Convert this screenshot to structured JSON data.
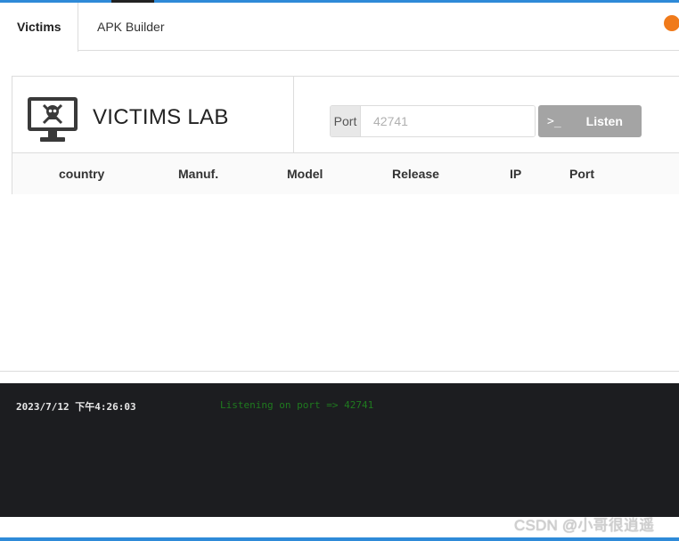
{
  "tabs": [
    {
      "label": "Victims",
      "active": true
    },
    {
      "label": "APK Builder",
      "active": false
    }
  ],
  "status_indicator": {
    "color": "#f07a1a"
  },
  "lab": {
    "title": "VICTIMS LAB",
    "icon": "monitor-skull-icon"
  },
  "port_control": {
    "label": "Port",
    "placeholder": "42741",
    "button_icon": "terminal-icon",
    "button_icon_glyph": ">_",
    "button_label": "Listen"
  },
  "table": {
    "columns": [
      "country",
      "Manuf.",
      "Model",
      "Release",
      "IP",
      "Port"
    ],
    "rows": []
  },
  "console": {
    "logs": [
      {
        "time": "2023/7/12 下午4:26:03",
        "message": "Listening on port => 42741"
      }
    ]
  },
  "watermark": "CSDN @小哥很逍遥",
  "colors": {
    "accent": "#2e8ad8",
    "button_disabled": "#a4a4a4",
    "console_bg": "#1c1d20",
    "log_message": "#1f7a1f"
  }
}
